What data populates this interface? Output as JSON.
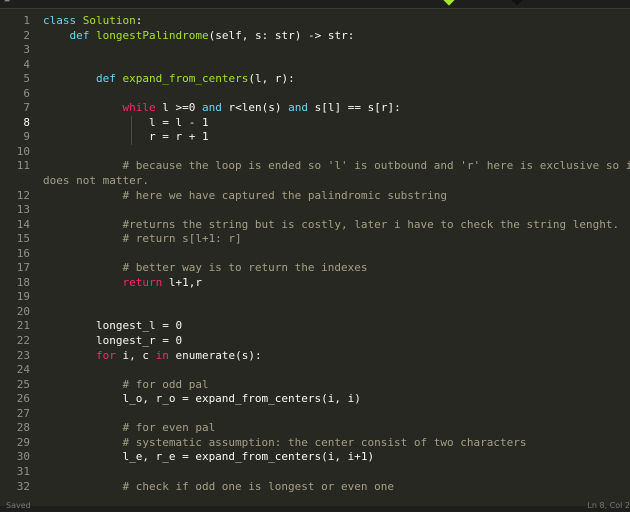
{
  "status": {
    "left": "Saved",
    "right": "Ln 8, Col 2"
  },
  "lines": [
    {
      "n": "1",
      "segs": [
        {
          "t": "class ",
          "c": "kw"
        },
        {
          "t": "Solution",
          "c": "cls"
        },
        {
          "t": ":",
          "c": "white"
        }
      ]
    },
    {
      "n": "2",
      "segs": [
        {
          "t": "    ",
          "c": "white"
        },
        {
          "t": "def ",
          "c": "kw"
        },
        {
          "t": "longestPalindrome",
          "c": "fn"
        },
        {
          "t": "(self, ",
          "c": "white"
        },
        {
          "t": "s",
          "c": "white"
        },
        {
          "t": ": ",
          "c": "white"
        },
        {
          "t": "str",
          "c": "white"
        },
        {
          "t": ") -> ",
          "c": "white"
        },
        {
          "t": "str",
          "c": "white"
        },
        {
          "t": ":",
          "c": "white"
        }
      ]
    },
    {
      "n": "3",
      "segs": []
    },
    {
      "n": "4",
      "segs": []
    },
    {
      "n": "5",
      "segs": [
        {
          "t": "        ",
          "c": "white"
        },
        {
          "t": "def ",
          "c": "kw"
        },
        {
          "t": "expand_from_centers",
          "c": "fn"
        },
        {
          "t": "(l, r):",
          "c": "white"
        }
      ]
    },
    {
      "n": "6",
      "segs": []
    },
    {
      "n": "7",
      "segs": [
        {
          "t": "            ",
          "c": "white"
        },
        {
          "t": "while ",
          "c": "op"
        },
        {
          "t": "l >=0 ",
          "c": "white"
        },
        {
          "t": "and ",
          "c": "kw"
        },
        {
          "t": "r<len(s) ",
          "c": "white"
        },
        {
          "t": "and ",
          "c": "kw"
        },
        {
          "t": "s[l] == s[r]:",
          "c": "white"
        }
      ]
    },
    {
      "n": "8",
      "active": true,
      "segs": [
        {
          "t": "                l = l - ",
          "c": "white"
        },
        {
          "t": "1",
          "c": "white"
        }
      ]
    },
    {
      "n": "9",
      "segs": [
        {
          "t": "                r = r + ",
          "c": "white"
        },
        {
          "t": "1",
          "c": "white"
        }
      ]
    },
    {
      "n": "10",
      "segs": []
    },
    {
      "n": "11",
      "segs": [
        {
          "t": "            # because the loop is ended so 'l' is outbound and 'r' here is exclusive so it",
          "c": "cm"
        }
      ],
      "wrap": [
        {
          "t": "does not matter.",
          "c": "cm"
        }
      ]
    },
    {
      "n": "12",
      "segs": [
        {
          "t": "            # here we have captured the palindromic substring",
          "c": "cm"
        }
      ]
    },
    {
      "n": "13",
      "segs": []
    },
    {
      "n": "14",
      "segs": [
        {
          "t": "            #returns the string but is costly, later i have to check the string lenght.",
          "c": "cm"
        }
      ]
    },
    {
      "n": "15",
      "segs": [
        {
          "t": "            # return s[l+1: r]",
          "c": "cm"
        }
      ]
    },
    {
      "n": "16",
      "segs": []
    },
    {
      "n": "17",
      "segs": [
        {
          "t": "            # better way is to return the indexes",
          "c": "cm"
        }
      ]
    },
    {
      "n": "18",
      "segs": [
        {
          "t": "            ",
          "c": "white"
        },
        {
          "t": "return ",
          "c": "op"
        },
        {
          "t": "l+1,r",
          "c": "white"
        }
      ]
    },
    {
      "n": "19",
      "segs": []
    },
    {
      "n": "20",
      "segs": []
    },
    {
      "n": "21",
      "segs": [
        {
          "t": "        longest_l = ",
          "c": "white"
        },
        {
          "t": "0",
          "c": "white"
        }
      ]
    },
    {
      "n": "22",
      "segs": [
        {
          "t": "        longest_r = ",
          "c": "white"
        },
        {
          "t": "0",
          "c": "white"
        }
      ]
    },
    {
      "n": "23",
      "segs": [
        {
          "t": "        ",
          "c": "white"
        },
        {
          "t": "for ",
          "c": "op"
        },
        {
          "t": "i, c ",
          "c": "white"
        },
        {
          "t": "in ",
          "c": "op"
        },
        {
          "t": "enumerate(s):",
          "c": "white"
        }
      ]
    },
    {
      "n": "24",
      "segs": []
    },
    {
      "n": "25",
      "segs": [
        {
          "t": "            # for odd pal",
          "c": "cm"
        }
      ]
    },
    {
      "n": "26",
      "segs": [
        {
          "t": "            l_o, r_o = expand_from_centers(i, i)",
          "c": "white"
        }
      ]
    },
    {
      "n": "27",
      "segs": []
    },
    {
      "n": "28",
      "segs": [
        {
          "t": "            # for even pal",
          "c": "cm"
        }
      ]
    },
    {
      "n": "29",
      "segs": [
        {
          "t": "            # systematic assumption: the center consist of two characters",
          "c": "cm"
        }
      ]
    },
    {
      "n": "30",
      "segs": [
        {
          "t": "            l_e, r_e = expand_from_centers(i, i+1)",
          "c": "white"
        }
      ]
    },
    {
      "n": "31",
      "segs": []
    },
    {
      "n": "32",
      "segs": [
        {
          "t": "            # check if odd one is longest or even one",
          "c": "cm"
        }
      ]
    }
  ]
}
